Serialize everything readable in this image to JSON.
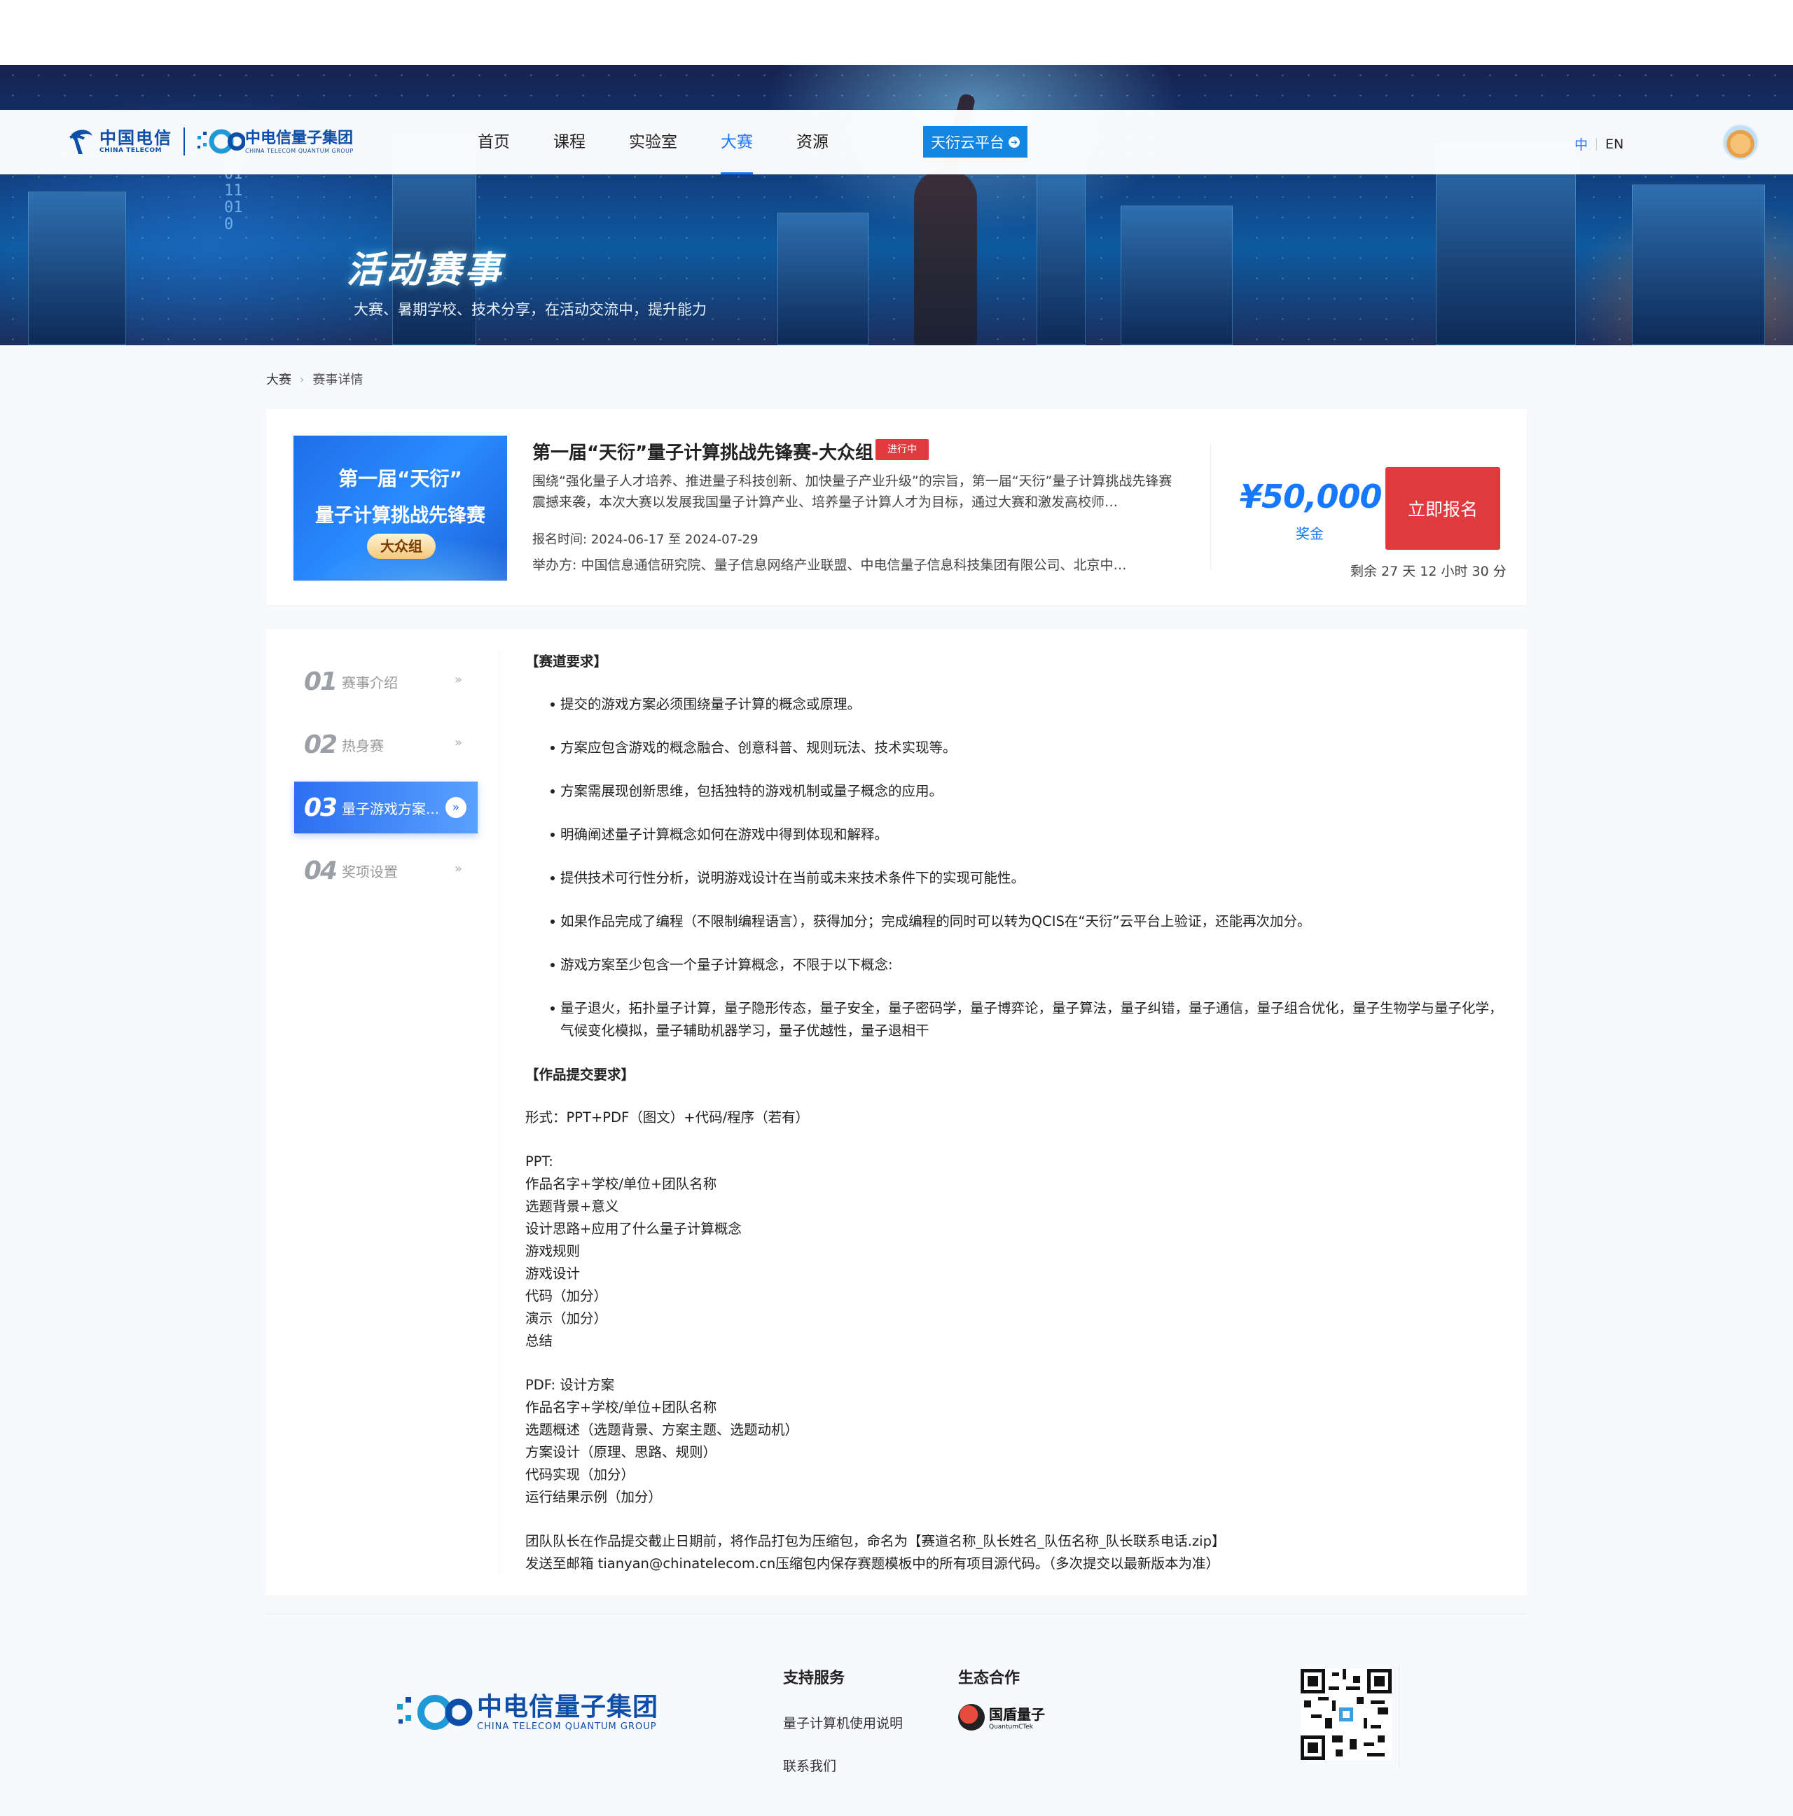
{
  "banner": {
    "title": "活动赛事",
    "subtitle": "大赛、暑期学校、技术分享，在活动交流中，提升能力"
  },
  "header": {
    "logo_ct": "中国电信",
    "logo_ct_en": "CHINA TELECOM",
    "logo_q": "中电信量子集团",
    "logo_q_en": "CHINA TELECOM QUANTUM GROUP",
    "nav": [
      "首页",
      "课程",
      "实验室",
      "大赛",
      "资源"
    ],
    "active_nav": "大赛",
    "cloud_button": "天衍云平台",
    "lang_zh": "中",
    "lang_en": "EN",
    "accent": "#1677ff"
  },
  "breadcrumb": {
    "root": "大赛",
    "current": "赛事详情"
  },
  "competition": {
    "thumb_line1": "第一届“天衍”",
    "thumb_line2": "量子计算挑战先锋赛",
    "thumb_tag": "大众组",
    "title": "第一届“天衍”量子计算挑战先锋赛-大众组",
    "status": "进行中",
    "status_color": "#e0393e",
    "description": "围绕“强化量子人才培养、推进量子科技创新、加快量子产业升级”的宗旨，第一届“天衍”量子计算挑战先锋赛震撼来袭，本次大赛以发展我国量子计算产业、培养量子计算人才为目标，通过大赛和激发高校师…",
    "signup_time_label": "报名时间:",
    "signup_time": "2024-06-17 至 2024-07-29",
    "organizer_label": "举办方:",
    "organizer": "中国信息通信研究院、量子信息网络产业联盟、中电信量子信息科技集团有限公司、北京中…",
    "prize": "¥50,000",
    "prize_label": "奖金",
    "signup_button": "立即报名",
    "remaining": "剩余 27 天 12 小时 30 分"
  },
  "sidebar": {
    "items": [
      {
        "num": "01",
        "label": "赛事介绍"
      },
      {
        "num": "02",
        "label": "热身赛"
      },
      {
        "num": "03",
        "label": "量子游戏方案..."
      },
      {
        "num": "04",
        "label": "奖项设置"
      }
    ],
    "active_index": 2
  },
  "content": {
    "track_heading": "【赛道要求】",
    "bullets": [
      "提交的游戏方案必须围绕量子计算的概念或原理。",
      "方案应包含游戏的概念融合、创意科普、规则玩法、技术实现等。",
      "方案需展现创新思维，包括独特的游戏机制或量子概念的应用。",
      "明确阐述量子计算概念如何在游戏中得到体现和解释。",
      "提供技术可行性分析，说明游戏设计在当前或未来技术条件下的实现可能性。",
      "如果作品完成了编程（不限制编程语言），获得加分；完成编程的同时可以转为QCIS在“天衍”云平台上验证，还能再次加分。",
      "游戏方案至少包含一个量子计算概念，不限于以下概念:",
      "量子退火，拓扑量子计算，量子隐形传态，量子安全，量子密码学，量子博弈论，量子算法，量子纠错，量子通信，量子组合优化，量子生物学与量子化学，气候变化模拟，量子辅助机器学习，量子优越性，量子退相干"
    ],
    "submit_heading": "【作品提交要求】",
    "format": "形式：PPT+PDF（图文）+代码/程序（若有）",
    "ppt_lines": [
      "PPT:",
      "作品名字+学校/单位+团队名称",
      "选题背景+意义",
      "设计思路+应用了什么量子计算概念",
      "游戏规则",
      "游戏设计",
      "代码（加分）",
      "演示（加分）",
      "总结"
    ],
    "pdf_lines": [
      "PDF: 设计方案",
      "作品名字+学校/单位+团队名称",
      "选题概述（选题背景、方案主题、选题动机）",
      "方案设计（原理、思路、规则）",
      "代码实现（加分）",
      "运行结果示例（加分）"
    ],
    "final_lines": [
      "团队队长在作品提交截止日期前，将作品打包为压缩包，命名为【赛道名称_队长姓名_队伍名称_队长联系电话.zip】",
      "发送至邮箱 tianyan@chinatelecom.cn压缩包内保存赛题模板中的所有项目源代码。（多次提交以最新版本为准）"
    ]
  },
  "footer": {
    "logo_text": "中电信量子集团",
    "logo_en": "CHINA TELECOM QUANTUM GROUP",
    "support_title": "支持服务",
    "support_links": [
      "量子计算机使用说明",
      "联系我们"
    ],
    "eco_title": "生态合作",
    "partner_name": "国盾量子",
    "partner_en": "QuantumCTek"
  }
}
